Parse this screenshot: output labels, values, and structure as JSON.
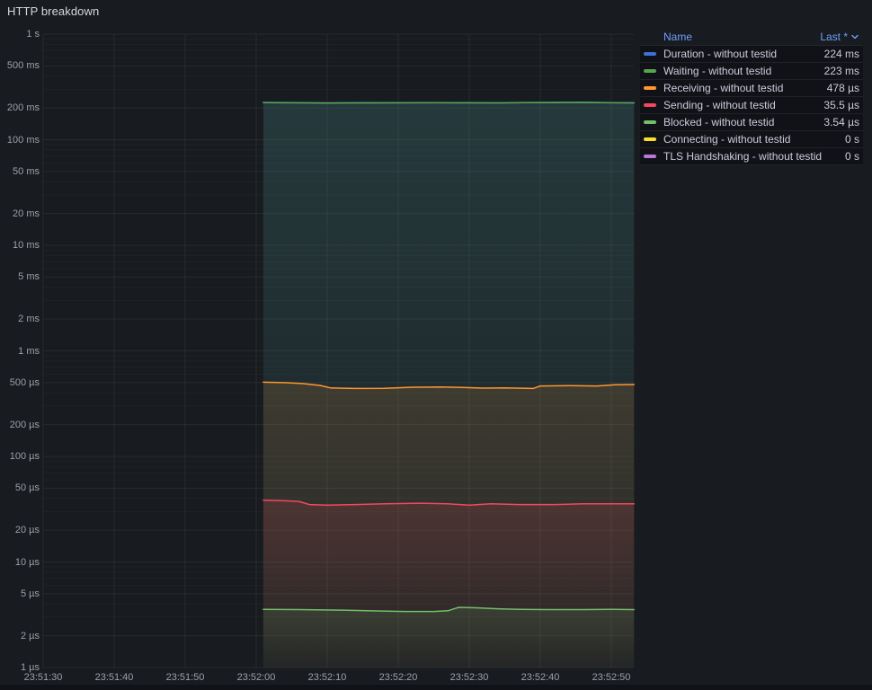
{
  "panel": {
    "title": "HTTP breakdown"
  },
  "colors": {
    "background": "#181b1f",
    "panel_edge": "#111217",
    "axis_text": "#9ea0ac",
    "legend_text": "#ccccdc",
    "link_blue": "#6e9fff",
    "grid_major": "rgba(255,255,255,0.065)",
    "grid_minor": "rgba(255,255,255,0.03)"
  },
  "legend": {
    "name_header": "Name",
    "last_header": "Last *",
    "sort_icon": "chevron-down",
    "rows": [
      {
        "name": "Duration - without testid",
        "last": "224 ms",
        "color": "#3D71D9"
      },
      {
        "name": "Waiting - without testid",
        "last": "223 ms",
        "color": "#56A64B"
      },
      {
        "name": "Receiving - without testid",
        "last": "478 µs",
        "color": "#FF9830"
      },
      {
        "name": "Sending - without testid",
        "last": "35.5 µs",
        "color": "#F2495C"
      },
      {
        "name": "Blocked - without testid",
        "last": "3.54 µs",
        "color": "#73BF69"
      },
      {
        "name": "Connecting - without testid",
        "last": "0 s",
        "color": "#FADE2A"
      },
      {
        "name": "TLS Handshaking - without testid",
        "last": "0 s",
        "color": "#B877D9"
      }
    ]
  },
  "chart_data": {
    "type": "line",
    "title": "HTTP breakdown",
    "y_axis": {
      "scale": "log10",
      "unit": "seconds",
      "range_seconds": [
        1e-06,
        1
      ],
      "ticks": [
        {
          "v": 1,
          "label": "1 s"
        },
        {
          "v": 0.5,
          "label": "500 ms"
        },
        {
          "v": 0.2,
          "label": "200 ms"
        },
        {
          "v": 0.1,
          "label": "100 ms"
        },
        {
          "v": 0.05,
          "label": "50 ms"
        },
        {
          "v": 0.02,
          "label": "20 ms"
        },
        {
          "v": 0.01,
          "label": "10 ms"
        },
        {
          "v": 0.005,
          "label": "5 ms"
        },
        {
          "v": 0.002,
          "label": "2 ms"
        },
        {
          "v": 0.001,
          "label": "1 ms"
        },
        {
          "v": 0.0005,
          "label": "500 µs"
        },
        {
          "v": 0.0002,
          "label": "200 µs"
        },
        {
          "v": 0.0001,
          "label": "100 µs"
        },
        {
          "v": 5e-05,
          "label": "50 µs"
        },
        {
          "v": 2e-05,
          "label": "20 µs"
        },
        {
          "v": 1e-05,
          "label": "10 µs"
        },
        {
          "v": 5e-06,
          "label": "5 µs"
        },
        {
          "v": 2e-06,
          "label": "2 µs"
        },
        {
          "v": 1e-06,
          "label": "1 µs"
        }
      ]
    },
    "x_axis": {
      "unit": "time",
      "tick_interval_seconds": 10,
      "ticks": [
        {
          "t": 0,
          "label": "23:51:30"
        },
        {
          "t": 10,
          "label": "23:51:40"
        },
        {
          "t": 20,
          "label": "23:51:50"
        },
        {
          "t": 30,
          "label": "23:52:00"
        },
        {
          "t": 40,
          "label": "23:52:10"
        },
        {
          "t": 50,
          "label": "23:52:20"
        },
        {
          "t": 60,
          "label": "23:52:30"
        },
        {
          "t": 70,
          "label": "23:52:40"
        },
        {
          "t": 80,
          "label": "23:52:50"
        }
      ]
    },
    "series": [
      {
        "name": "Duration - without testid",
        "color": "#3D71D9",
        "last": "224 ms",
        "points": [
          [
            31,
            0.2255
          ],
          [
            36,
            0.2245
          ],
          [
            40,
            0.2235
          ],
          [
            45,
            0.224
          ],
          [
            50,
            0.2245
          ],
          [
            55,
            0.2248
          ],
          [
            60,
            0.2242
          ],
          [
            64,
            0.2238
          ],
          [
            68,
            0.225
          ],
          [
            72,
            0.2258
          ],
          [
            76,
            0.2262
          ],
          [
            80,
            0.2248
          ],
          [
            83.2,
            0.224
          ]
        ]
      },
      {
        "name": "Waiting - without testid",
        "color": "#56A64B",
        "last": "223 ms",
        "points": [
          [
            31,
            0.2245
          ],
          [
            36,
            0.2235
          ],
          [
            40,
            0.2225
          ],
          [
            45,
            0.223
          ],
          [
            50,
            0.2235
          ],
          [
            55,
            0.2238
          ],
          [
            60,
            0.2232
          ],
          [
            64,
            0.2228
          ],
          [
            68,
            0.224
          ],
          [
            72,
            0.2248
          ],
          [
            76,
            0.2252
          ],
          [
            80,
            0.2238
          ],
          [
            83.2,
            0.223
          ]
        ]
      },
      {
        "name": "Receiving - without testid",
        "color": "#FF9830",
        "last": "478 µs",
        "points": [
          [
            31,
            0.000505
          ],
          [
            34,
            0.0005
          ],
          [
            36.5,
            0.00049
          ],
          [
            39,
            0.00047
          ],
          [
            40.5,
            0.000445
          ],
          [
            44,
            0.00044
          ],
          [
            48,
            0.000442
          ],
          [
            52,
            0.000452
          ],
          [
            56,
            0.000455
          ],
          [
            59,
            0.00045
          ],
          [
            62,
            0.000443
          ],
          [
            65,
            0.000445
          ],
          [
            69,
            0.00044
          ],
          [
            70,
            0.000465
          ],
          [
            74,
            0.000468
          ],
          [
            78,
            0.000465
          ],
          [
            80.5,
            0.000478
          ],
          [
            83.2,
            0.00048
          ]
        ]
      },
      {
        "name": "Sending - without testid",
        "color": "#F2495C",
        "last": "35.5 µs",
        "points": [
          [
            31,
            3.85e-05
          ],
          [
            34,
            3.8e-05
          ],
          [
            36,
            3.75e-05
          ],
          [
            37.5,
            3.5e-05
          ],
          [
            40,
            3.45e-05
          ],
          [
            44,
            3.5e-05
          ],
          [
            48,
            3.55e-05
          ],
          [
            53,
            3.6e-05
          ],
          [
            57,
            3.55e-05
          ],
          [
            60,
            3.45e-05
          ],
          [
            63,
            3.55e-05
          ],
          [
            67,
            3.5e-05
          ],
          [
            72,
            3.5e-05
          ],
          [
            76,
            3.55e-05
          ],
          [
            80,
            3.55e-05
          ],
          [
            83.2,
            3.55e-05
          ]
        ]
      },
      {
        "name": "Blocked - without testid",
        "color": "#73BF69",
        "last": "3.54 µs",
        "points": [
          [
            31,
            3.56e-06
          ],
          [
            36,
            3.54e-06
          ],
          [
            42,
            3.5e-06
          ],
          [
            47,
            3.44e-06
          ],
          [
            51,
            3.4e-06
          ],
          [
            55,
            3.4e-06
          ],
          [
            57,
            3.45e-06
          ],
          [
            58.5,
            3.72e-06
          ],
          [
            61,
            3.68e-06
          ],
          [
            64,
            3.6e-06
          ],
          [
            67,
            3.56e-06
          ],
          [
            71,
            3.54e-06
          ],
          [
            76,
            3.54e-06
          ],
          [
            80,
            3.55e-06
          ],
          [
            83.2,
            3.54e-06
          ]
        ]
      },
      {
        "name": "Connecting - without testid",
        "color": "#FADE2A",
        "last": "0 s",
        "points": []
      },
      {
        "name": "TLS Handshaking - without testid",
        "color": "#B877D9",
        "last": "0 s",
        "points": []
      }
    ],
    "legend_position": "right-table",
    "grid": true
  }
}
